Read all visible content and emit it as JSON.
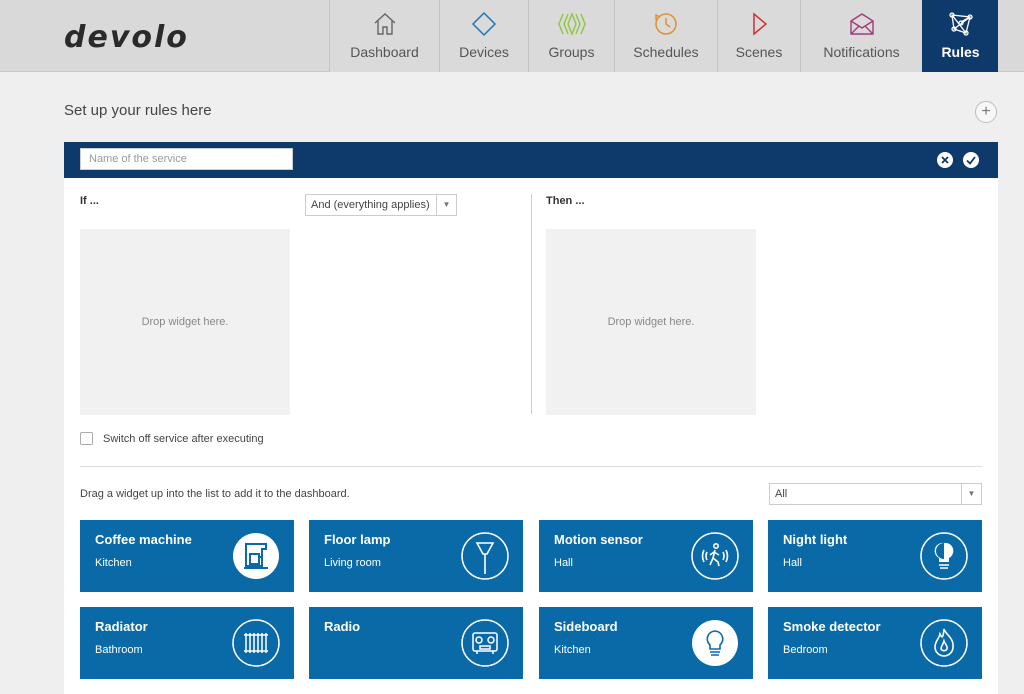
{
  "app": {
    "logo_text": "devolo"
  },
  "nav": {
    "tabs": [
      {
        "label": "Dashboard",
        "icon": "home-icon",
        "color": "#666666"
      },
      {
        "label": "Devices",
        "icon": "diamond-icon",
        "color": "#1e78b4"
      },
      {
        "label": "Groups",
        "icon": "groups-icon",
        "color": "#8dc63f"
      },
      {
        "label": "Schedules",
        "icon": "clock-icon",
        "color": "#e0922e"
      },
      {
        "label": "Scenes",
        "icon": "play-icon",
        "color": "#cc3333"
      },
      {
        "label": "Notifications",
        "icon": "envelope-icon",
        "color": "#a33a7a"
      },
      {
        "label": "Rules",
        "icon": "network-icon",
        "active": true
      }
    ]
  },
  "page": {
    "title": "Set up your rules here",
    "add_button_symbol": "+"
  },
  "rule": {
    "name_placeholder": "Name of the service",
    "if_label": "If ...",
    "then_label": "Then ...",
    "logic_select_value": "And (everything applies)",
    "drop_if_text": "Drop widget here.",
    "drop_then_text": "Drop widget here.",
    "switch_off_label": "Switch off service after executing"
  },
  "widget_list": {
    "hint": "Drag a widget up into the list to add it to the dashboard.",
    "filter_value": "All",
    "widgets": [
      {
        "name": "Coffee machine",
        "room": "Kitchen",
        "icon": "coffee-machine-icon"
      },
      {
        "name": "Floor lamp",
        "room": "Living room",
        "icon": "floor-lamp-icon"
      },
      {
        "name": "Motion sensor",
        "room": "Hall",
        "icon": "motion-sensor-icon"
      },
      {
        "name": "Night light",
        "room": "Hall",
        "icon": "night-light-icon"
      },
      {
        "name": "Radiator",
        "room": "Bathroom",
        "icon": "radiator-icon"
      },
      {
        "name": "Radio",
        "room": "",
        "icon": "radio-icon"
      },
      {
        "name": "Sideboard",
        "room": "Kitchen",
        "icon": "lightbulb-icon"
      },
      {
        "name": "Smoke detector",
        "room": "Bedroom",
        "icon": "flame-icon"
      }
    ]
  },
  "colors": {
    "header_blue": "#0e3a6b",
    "widget_blue": "#0a6aa8"
  }
}
